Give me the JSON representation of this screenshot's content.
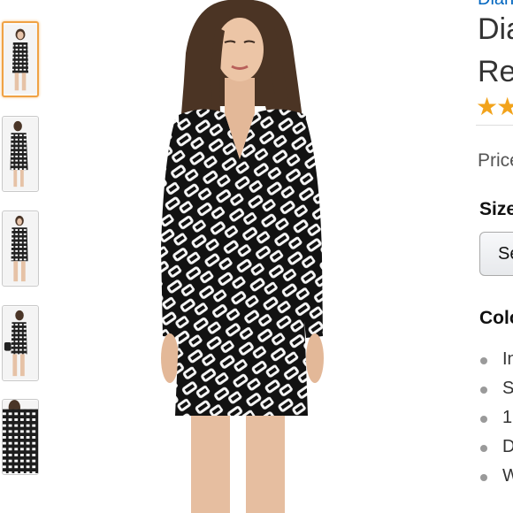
{
  "brand_link": "Diane",
  "title_line1": "Dia",
  "title_line2": "Re",
  "rating": {
    "stars_shown": 2
  },
  "price_label": "Price",
  "size": {
    "label": "Size",
    "select_text": "Se"
  },
  "color_label": "Colo",
  "bullets": [
    "In",
    "S",
    "1",
    "D",
    "W"
  ],
  "colors": {
    "accent": "#f0a244",
    "link": "#0066c0",
    "star": "#f2a31b"
  },
  "thumbnails": [
    {
      "name": "thumb-front",
      "selected": true
    },
    {
      "name": "thumb-side",
      "selected": false
    },
    {
      "name": "thumb-front-2",
      "selected": false
    },
    {
      "name": "thumb-back",
      "selected": false
    },
    {
      "name": "thumb-detail",
      "selected": false
    }
  ]
}
